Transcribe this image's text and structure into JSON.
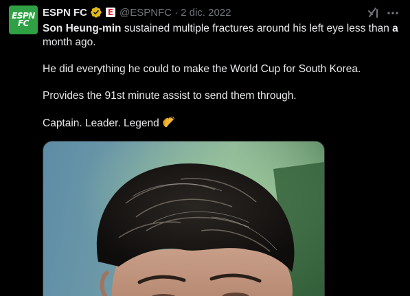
{
  "account": {
    "avatar_logo_top": "ESPN",
    "avatar_logo_bottom": "FC",
    "display_name": "ESPN FC",
    "affiliate_badge": "E",
    "handle": "@ESPNFC",
    "separator": "·",
    "date": "2 dic. 2022"
  },
  "icons": {
    "verified": "verified-badge-icon",
    "affiliate": "espn-affiliate-badge-icon",
    "grok": "grok-icon",
    "more": "more-options-icon",
    "clap": "clapping-hands-emoji"
  },
  "tweet": {
    "line1_bold_start": "Son Heung-min",
    "line1_middle": " sustained multiple fractures around his left eye less than ",
    "line1_bold_end": "a",
    "line1_rest": " month ago.",
    "line2": "He did everything he could to make the World Cup for South Korea.",
    "line3": "Provides the 91st minute assist to send them through.",
    "line4": "Captain. Leader. Legend"
  },
  "colors": {
    "background": "#000000",
    "text": "#e7e9ea",
    "secondary_text": "#71767b",
    "verified_gold": "#e2b719",
    "avatar_green": "#2fa043"
  }
}
